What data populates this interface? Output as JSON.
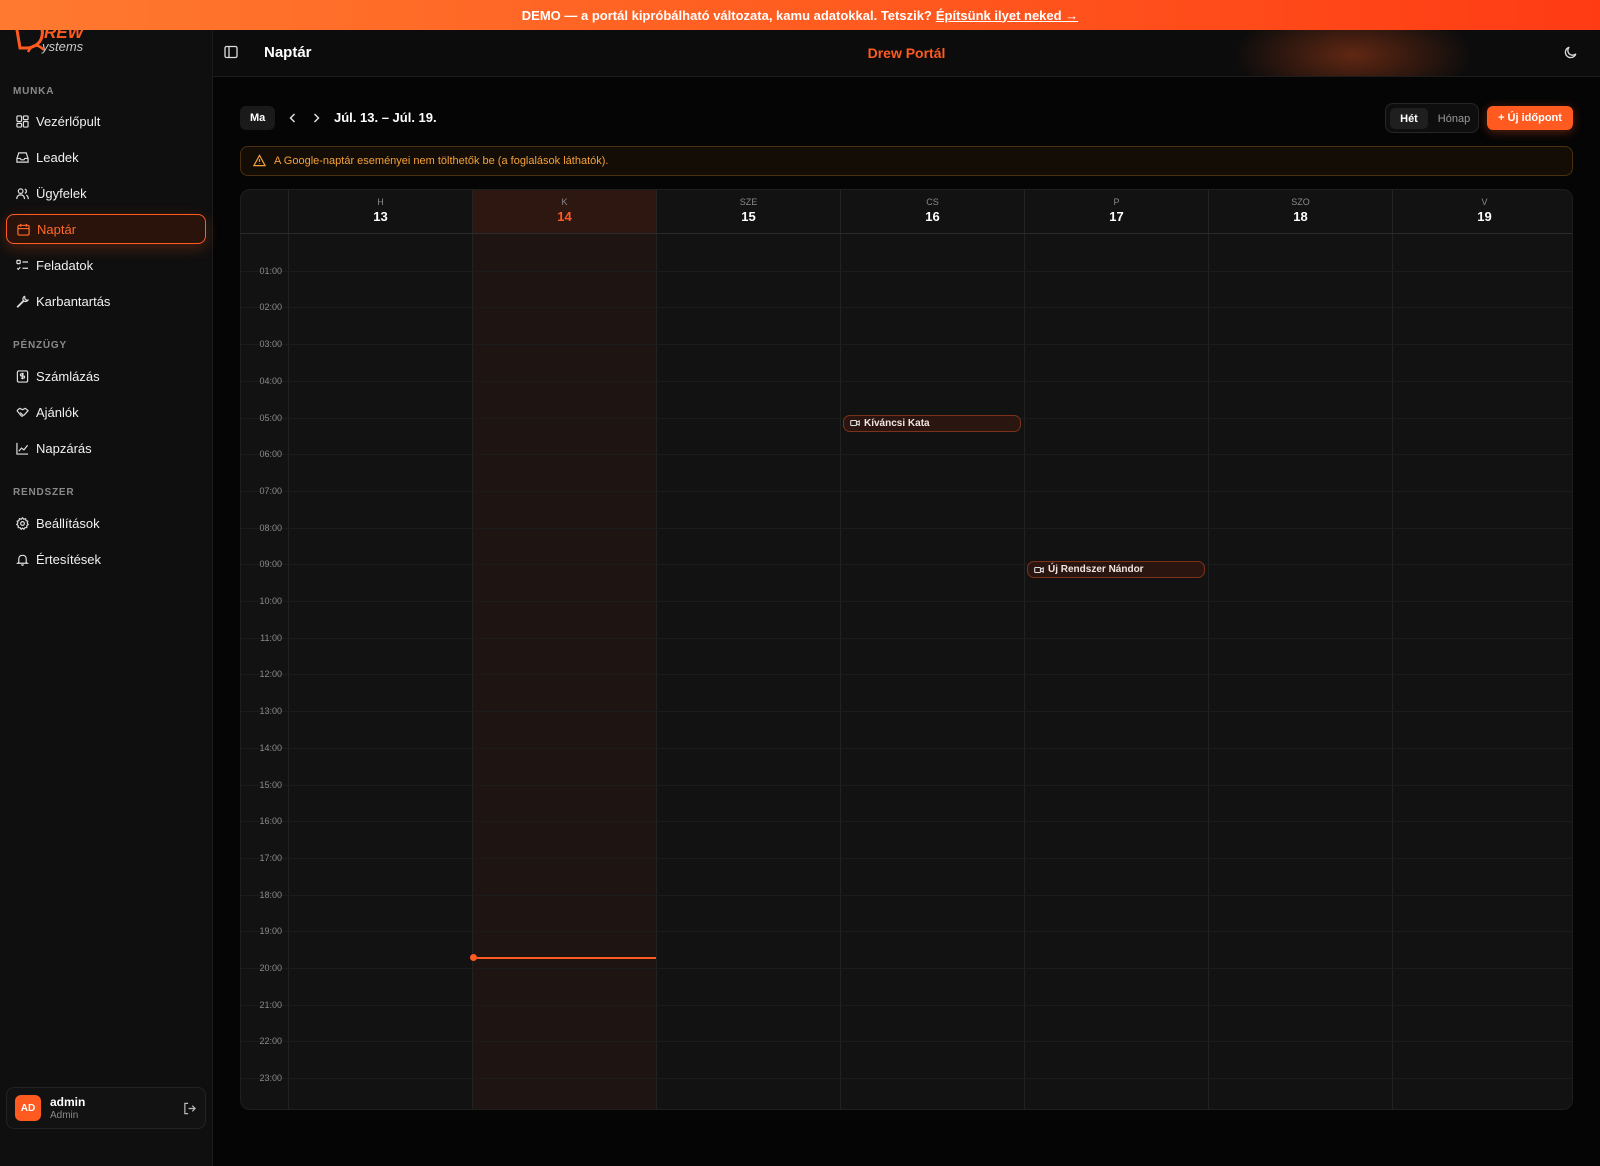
{
  "banner": {
    "text": "DEMO — a portál kipróbálható változata, kamu adatokkal. Tetszik?",
    "link": "Építsünk ilyet neked →"
  },
  "sidebar": {
    "logo": "DREW systems",
    "sections": [
      {
        "label": "MUNKA",
        "items": [
          {
            "label": "Vezérlőpult",
            "icon": "dashboard-icon"
          },
          {
            "label": "Leadek",
            "icon": "inbox-icon"
          },
          {
            "label": "Ügyfelek",
            "icon": "users-icon"
          },
          {
            "label": "Naptár",
            "icon": "calendar-icon",
            "active": true
          },
          {
            "label": "Feladatok",
            "icon": "checklist-icon"
          },
          {
            "label": "Karbantartás",
            "icon": "wrench-icon"
          }
        ]
      },
      {
        "label": "PÉNZÜGY",
        "items": [
          {
            "label": "Számlázás",
            "icon": "invoice-icon"
          },
          {
            "label": "Ajánlók",
            "icon": "handshake-icon"
          },
          {
            "label": "Napzárás",
            "icon": "chart-line-icon"
          }
        ]
      },
      {
        "label": "RENDSZER",
        "items": [
          {
            "label": "Beállítások",
            "icon": "gear-icon"
          },
          {
            "label": "Értesítések",
            "icon": "bell-icon"
          }
        ]
      }
    ],
    "user": {
      "initials": "AD",
      "name": "admin",
      "role": "Admin"
    }
  },
  "header": {
    "title": "Naptár",
    "brand": "Drew Portál"
  },
  "toolbar": {
    "today": "Ma",
    "range": "Júl. 13. – Júl. 19.",
    "view_week": "Hét",
    "view_month": "Hónap",
    "new_button": "+ Új időpont"
  },
  "alert": {
    "text": "A Google-naptár eseményei nem tölthetők be (a foglalások láthatók)."
  },
  "calendar": {
    "days": [
      {
        "dow": "H",
        "num": "13"
      },
      {
        "dow": "K",
        "num": "14",
        "today": true
      },
      {
        "dow": "SZE",
        "num": "15"
      },
      {
        "dow": "CS",
        "num": "16"
      },
      {
        "dow": "P",
        "num": "17"
      },
      {
        "dow": "SZO",
        "num": "18"
      },
      {
        "dow": "V",
        "num": "19"
      }
    ],
    "hours": [
      "01:00",
      "02:00",
      "03:00",
      "04:00",
      "05:00",
      "06:00",
      "07:00",
      "08:00",
      "09:00",
      "10:00",
      "11:00",
      "12:00",
      "13:00",
      "14:00",
      "15:00",
      "16:00",
      "17:00",
      "18:00",
      "19:00",
      "20:00",
      "21:00",
      "22:00",
      "23:00"
    ],
    "events": [
      {
        "title": "Kíváncsi Kata",
        "day": 3,
        "start_hour": 5.0,
        "icon": "video-icon"
      },
      {
        "title": "Új Rendszer Nándor",
        "day": 4,
        "start_hour": 9.0,
        "icon": "video-icon"
      }
    ],
    "now": {
      "day": 1,
      "hour": 19.7
    }
  },
  "colors": {
    "accent": "#ff5a1f",
    "background": "#050505",
    "surface": "#121212",
    "warning": "#f5a13a"
  }
}
